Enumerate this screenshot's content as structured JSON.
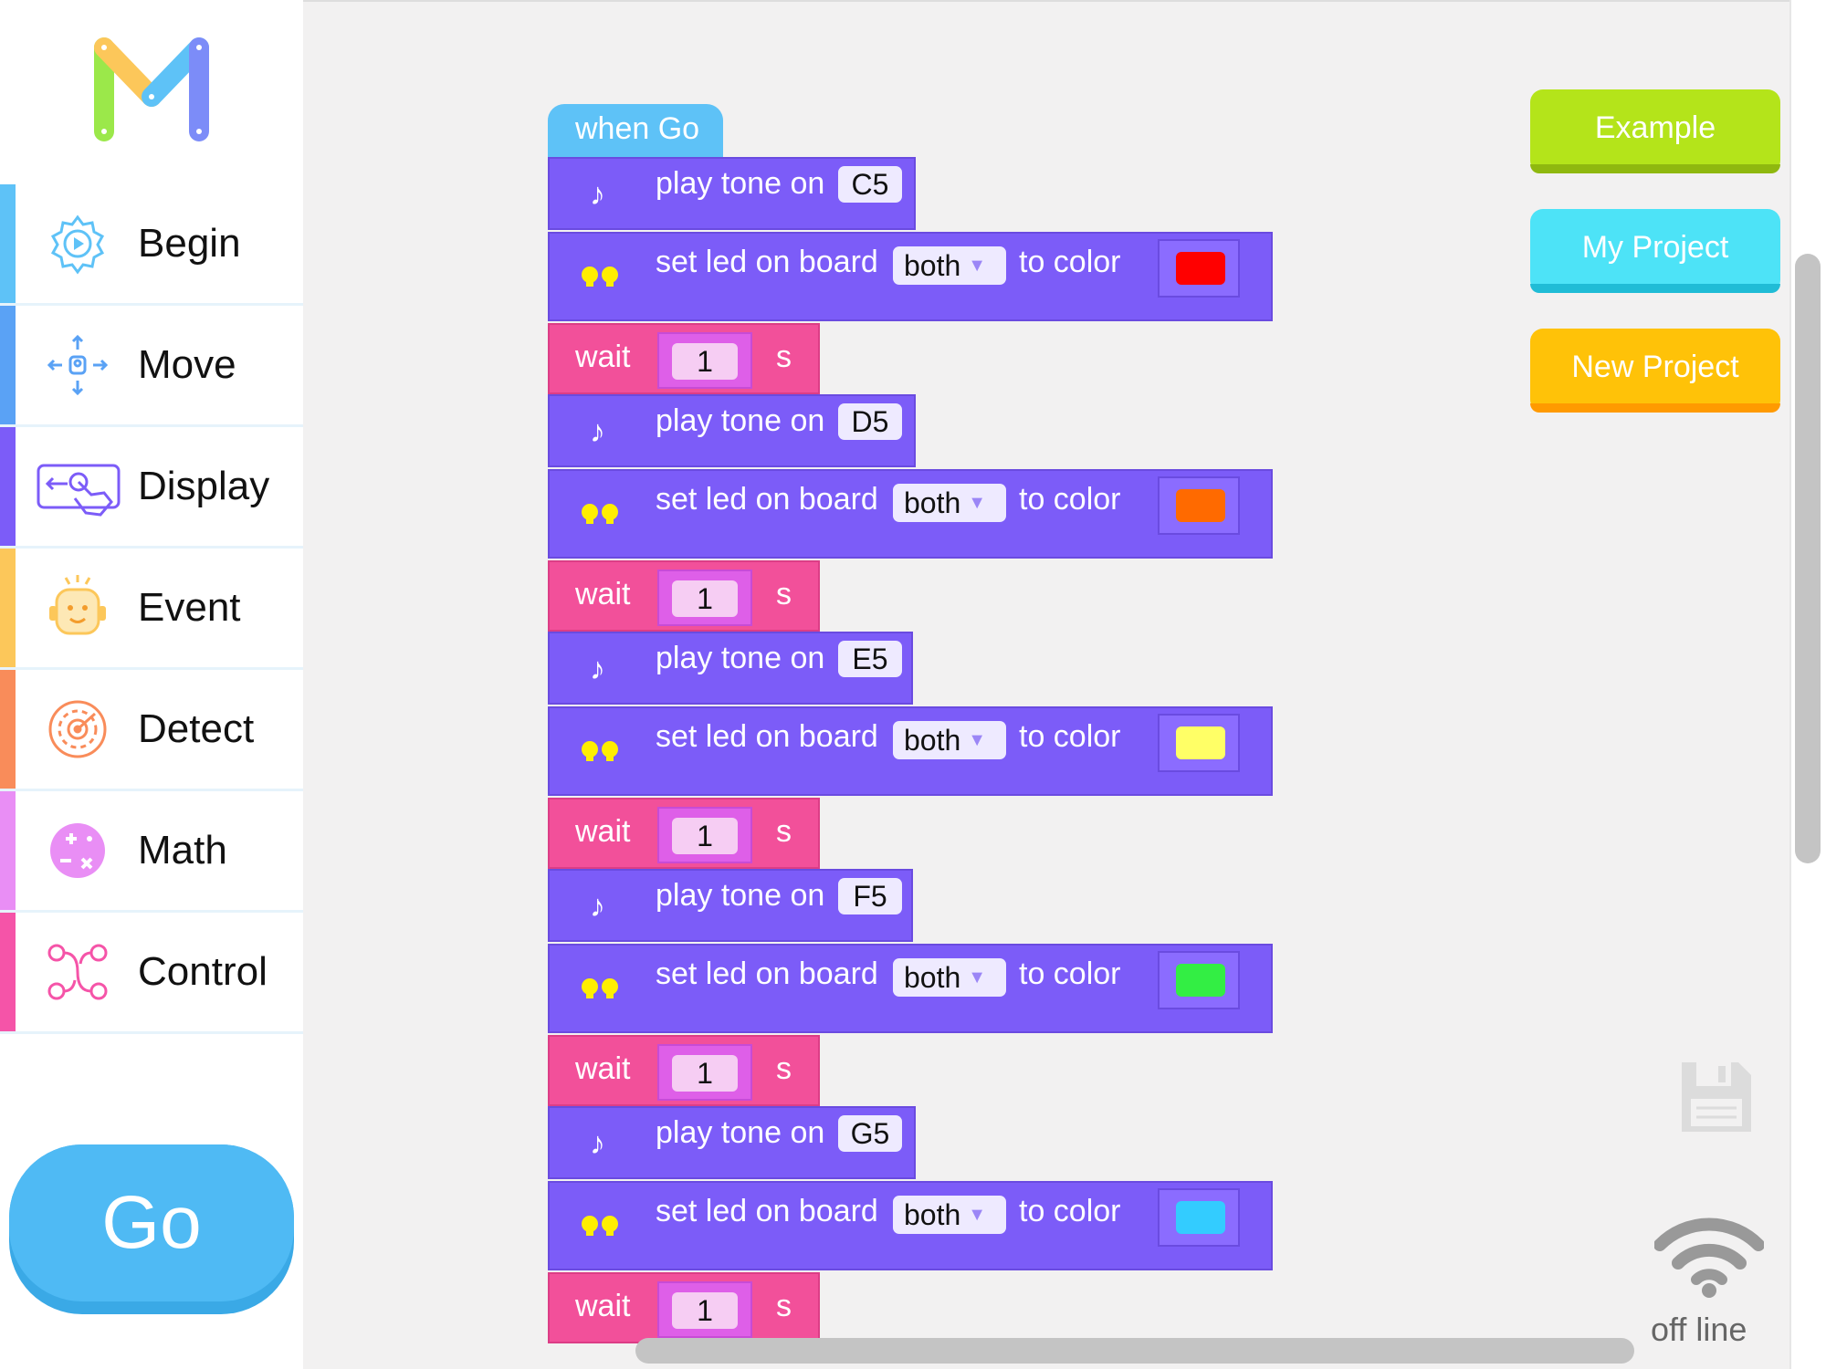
{
  "sidebar": {
    "items": [
      {
        "label": "Begin",
        "icon": "play-gear-icon",
        "color": "#5ec2f7"
      },
      {
        "label": "Move",
        "icon": "robot-move-icon",
        "color": "#5aa2f5"
      },
      {
        "label": "Display",
        "icon": "touch-display-icon",
        "color": "#7c5cf8"
      },
      {
        "label": "Event",
        "icon": "smiley-robot-icon",
        "color": "#fcc75a"
      },
      {
        "label": "Detect",
        "icon": "radar-icon",
        "color": "#f98c5a"
      },
      {
        "label": "Math",
        "icon": "math-ball-icon",
        "color": "#e98ef5"
      },
      {
        "label": "Control",
        "icon": "branch-icon",
        "color": "#f554a8"
      }
    ],
    "go_label": "Go"
  },
  "workspace": {
    "hat_label": "when Go",
    "sequence": [
      {
        "tone": "C5",
        "led": "both",
        "color": "#ff0000",
        "wait": "1"
      },
      {
        "tone": "D5",
        "led": "both",
        "color": "#ff6a00",
        "wait": "1"
      },
      {
        "tone": "E5",
        "led": "both",
        "color": "#ffff66",
        "wait": "1"
      },
      {
        "tone": "F5",
        "led": "both",
        "color": "#33ee44",
        "wait": "1"
      },
      {
        "tone": "G5",
        "led": "both",
        "color": "#33ccff",
        "wait": "1"
      }
    ],
    "labels": {
      "play_tone": "play tone on",
      "set_led": "set led on board",
      "to_color": "to color",
      "wait": "wait",
      "seconds": "s"
    }
  },
  "actions": {
    "example": "Example",
    "my_project": "My Project",
    "new_project": "New Project"
  },
  "status": {
    "connection": "off line"
  },
  "colors": {
    "purple_block": "#7c5cf8",
    "pink_block": "#f2509a",
    "hat_block": "#5ec2f7",
    "example_btn": "#b4e41a",
    "my_project_btn": "#4de3f7",
    "new_project_btn": "#ffc208"
  }
}
